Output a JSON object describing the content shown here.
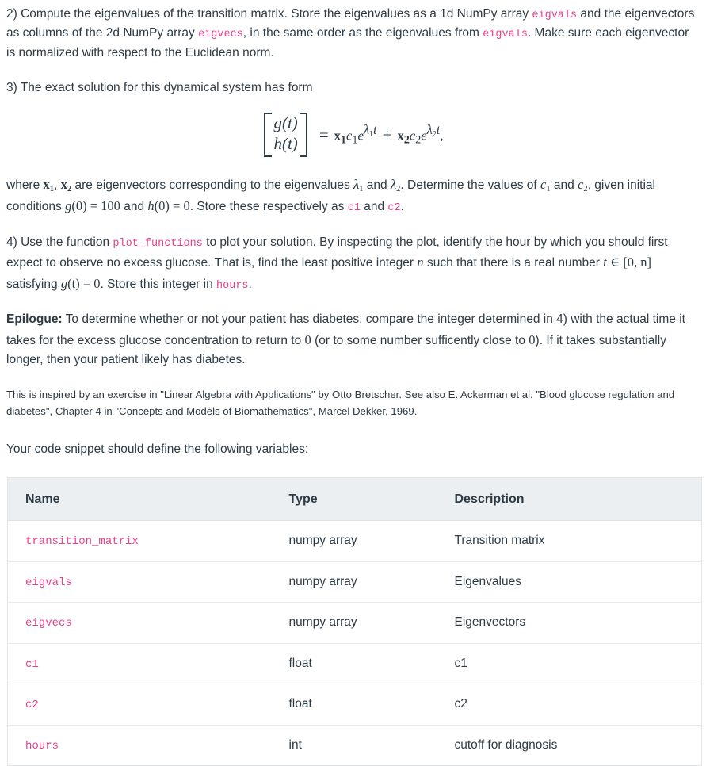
{
  "steps": {
    "step2": {
      "prefix": "2) Compute the eigenvalues of the transition matrix. Store the eigenvalues as a 1d NumPy array ",
      "code1": "eigvals",
      "mid1": " and the eigenvectors as columns of the 2d NumPy array ",
      "code2": "eigvecs",
      "mid2": ", in the same order as the eigenvalues from ",
      "code3": "eigvals",
      "suffix": ". Make sure each eigenvector is normalized with respect to the Euclidean norm."
    },
    "step3": {
      "text": "3) The exact solution for this dynamical system has form"
    },
    "step3_after": {
      "p1_a": "where ",
      "p1_x1": "x",
      "p1_x1_sub": "1",
      "p1_comma": ", ",
      "p1_x2": "x",
      "p1_x2_sub": "2",
      "p1_b": " are eigenvectors corresponding to the eigenvalues ",
      "p1_l1": "λ",
      "p1_l1_sub": "1",
      "p1_and": " and ",
      "p1_l2": "λ",
      "p1_l2_sub": "2",
      "p1_c": ". Determine the values of ",
      "p1_c1": "c",
      "p1_c1_sub": "1",
      "p1_d": " and ",
      "p1_c2": "c",
      "p1_c2_sub": "2",
      "p1_e": ", given initial conditions ",
      "p1_g0": "g",
      "p1_g0_args": "(0)",
      "p1_eq100": " = 100",
      "p1_f": " and ",
      "p1_h0": "h",
      "p1_h0_args": "(0)",
      "p1_eq0": " = 0",
      "p1_g": ". Store these respectively as ",
      "code_c1": "c1",
      "p1_h": " and ",
      "code_c2": "c2",
      "p1_i": "."
    },
    "step4": {
      "a": "4) Use the function ",
      "code1": "plot_functions",
      "b": " to plot your solution. By inspecting the plot, identify the hour by which you should first expect to observe no excess glucose. That is, find the least positive integer ",
      "n": "n",
      "c": " such that there is a real number ",
      "t": "t",
      "in": " ∈ ",
      "interval": "[0, n]",
      "d": " satisfying ",
      "gt": "g",
      "gt_args": "(t)",
      "gt_eq": " = 0",
      "e": ". Store this integer in ",
      "code2": "hours",
      "f": "."
    },
    "epilogue": {
      "label": "Epilogue:",
      "a": " To determine whether or not your patient has diabetes, compare the integer determined in 4) with the actual time it takes for the excess glucose concentration to return to ",
      "zero1": "0",
      "b": " (or to some number sufficently close to ",
      "zero2": "0",
      "c": "). If it takes substantially longer, then your patient likely has diabetes."
    }
  },
  "equation": {
    "matrix_row1": "g(t)",
    "matrix_row2": "h(t)",
    "equals": "=",
    "term1_vec": "x",
    "term1_vec_sub": "1",
    "term1_c": "c",
    "term1_c_sub": "1",
    "term1_e": "e",
    "term1_exp_lambda": "λ",
    "term1_exp_sub": "1",
    "term1_exp_t": "t",
    "plus": "+",
    "term2_vec": "x",
    "term2_vec_sub": "2",
    "term2_c": "c",
    "term2_c_sub": "2",
    "term2_e": "e",
    "term2_exp_lambda": "λ",
    "term2_exp_sub": "2",
    "term2_exp_t": "t",
    "trailing_comma": ","
  },
  "citation": {
    "text": "This is inspired by an exercise in \"Linear Algebra with Applications\" by Otto Bretscher. See also E. Ackerman et al. \"Blood glucose regulation and diabetes\", Chapter 4 in \"Concepts and Models of Biomathematics\", Marcel Dekker, 1969."
  },
  "table_intro": {
    "text": "Your code snippet should define the following variables:"
  },
  "table": {
    "headers": [
      "Name",
      "Type",
      "Description"
    ],
    "rows": [
      {
        "name": "transition_matrix",
        "type": "numpy array",
        "description": "Transition matrix"
      },
      {
        "name": "eigvals",
        "type": "numpy array",
        "description": "Eigenvalues"
      },
      {
        "name": "eigvecs",
        "type": "numpy array",
        "description": "Eigenvectors"
      },
      {
        "name": "c1",
        "type": "float",
        "description": "c1"
      },
      {
        "name": "c2",
        "type": "float",
        "description": "c2"
      },
      {
        "name": "hours",
        "type": "int",
        "description": "cutoff for diagnosis"
      }
    ]
  },
  "colors": {
    "code_pink": "#e83e8c",
    "body_text": "#2d3b45",
    "table_header_bg": "#eceff1",
    "table_border": "#e3e5e8"
  }
}
